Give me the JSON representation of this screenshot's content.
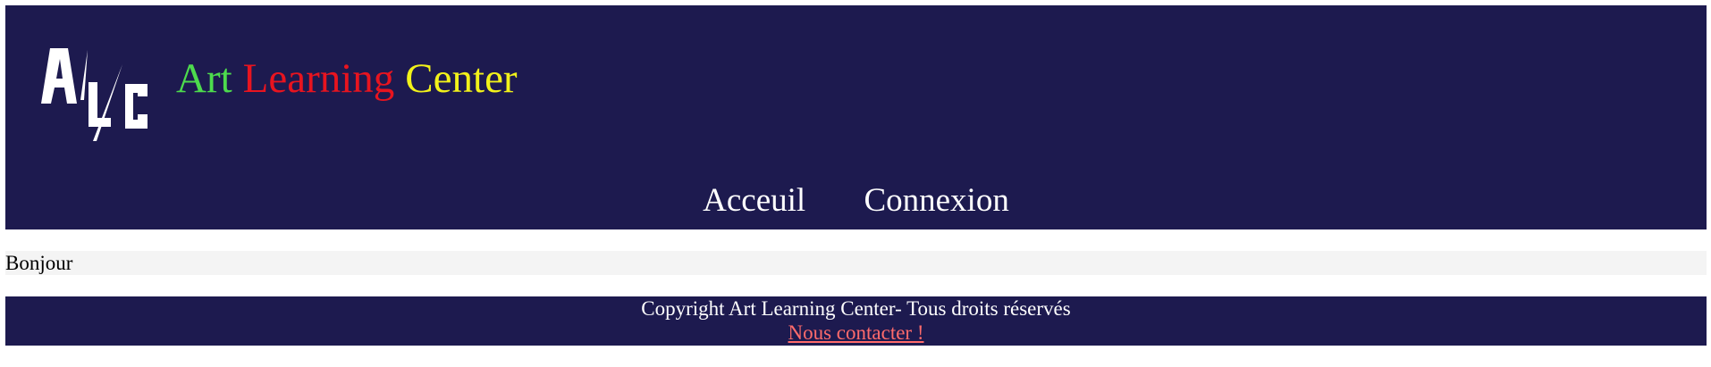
{
  "header": {
    "logo_text": "ALC",
    "title_parts": [
      {
        "text": "Art",
        "color": "#4ddb4d"
      },
      {
        "text": "Learning",
        "color": "#e8141f"
      },
      {
        "text": "Center",
        "color": "#f2f21a"
      }
    ],
    "nav": [
      {
        "label": "Acceuil"
      },
      {
        "label": "Connexion"
      }
    ]
  },
  "main": {
    "greeting": "Bonjour"
  },
  "footer": {
    "copyright": "Copyright Art Learning Center- Tous droits réservés",
    "contact_link": "Nous contacter !"
  },
  "colors": {
    "navy_background": "#1d1a4f",
    "contact_link": "#ff6b6b",
    "greeting_background": "#f4f4f4"
  }
}
